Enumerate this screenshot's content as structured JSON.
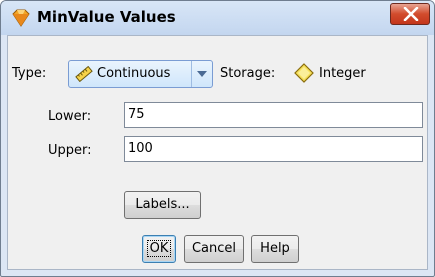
{
  "window": {
    "title": "MinValue Values",
    "title_icon": "diamond-gem-icon",
    "close_icon": "close-x-icon"
  },
  "type_row": {
    "type_label": "Type:",
    "type_value": "Continuous",
    "type_icon": "ruler-icon",
    "storage_label": "Storage:",
    "storage_value": "Integer",
    "storage_icon": "diamond-icon"
  },
  "fields": {
    "lower_label": "Lower:",
    "lower_value": "75",
    "upper_label": "Upper:",
    "upper_value": "100"
  },
  "buttons": {
    "labels": "Labels...",
    "ok": "OK",
    "cancel": "Cancel",
    "help": "Help"
  },
  "colors": {
    "accent": "#f0a020",
    "close_red": "#c3361c"
  }
}
